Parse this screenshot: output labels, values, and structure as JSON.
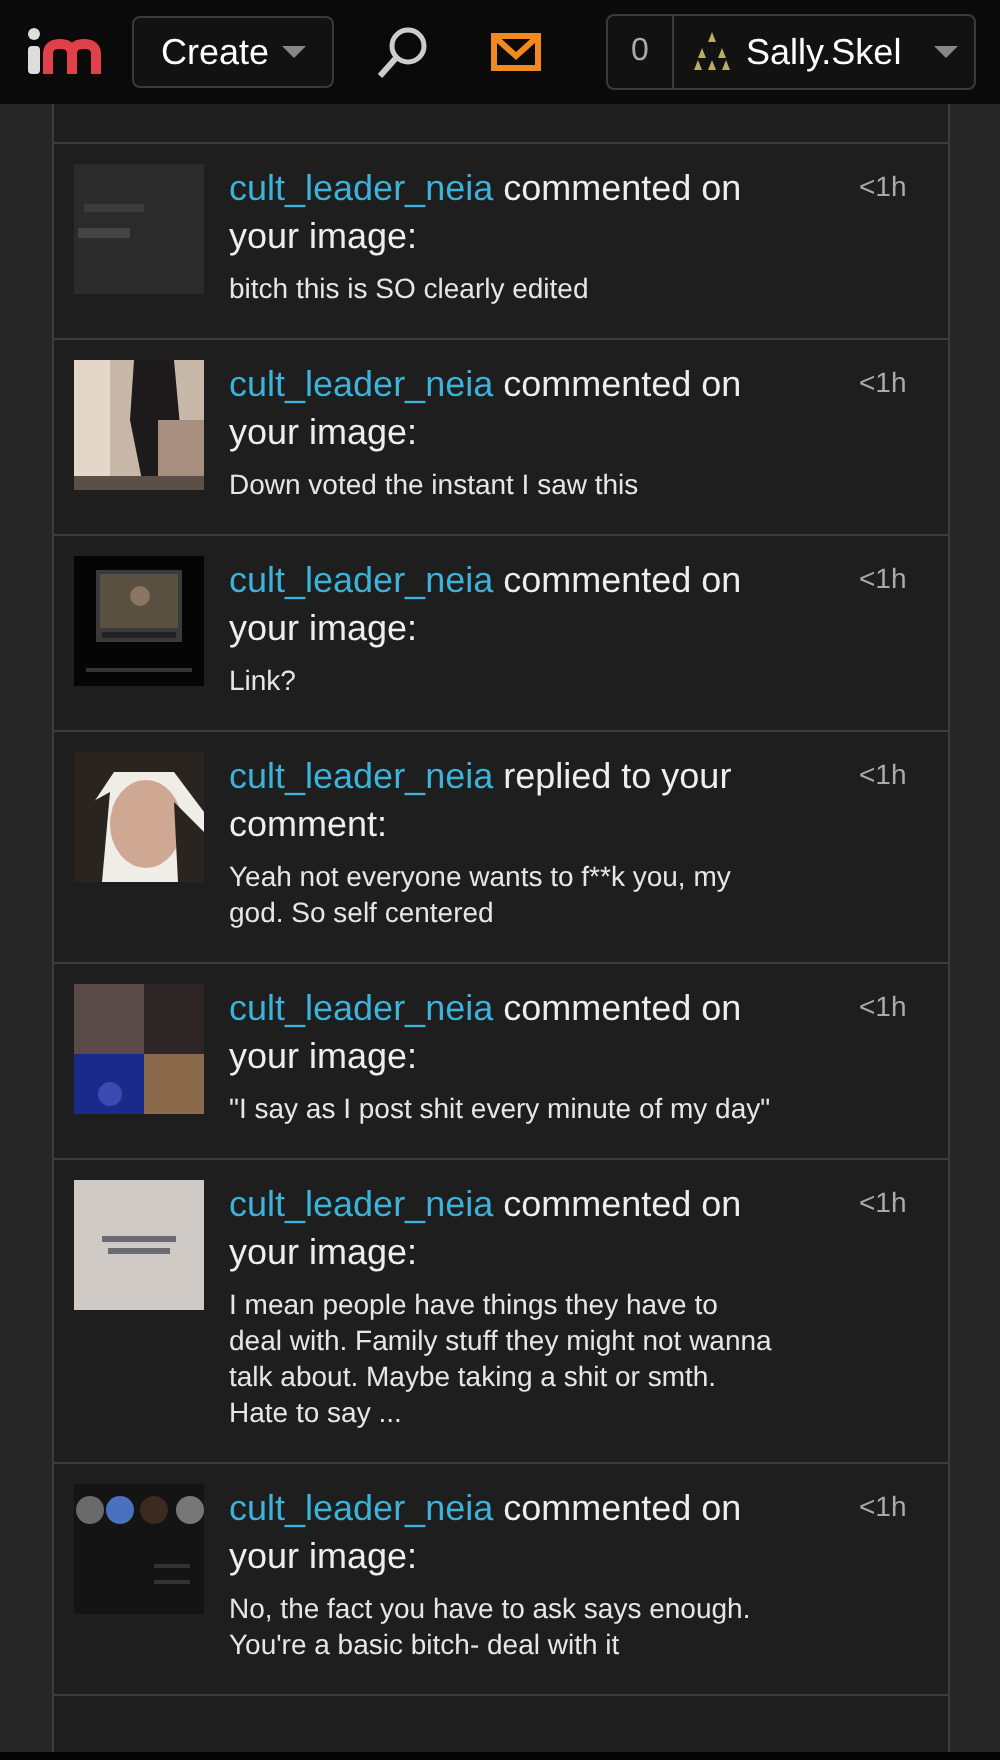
{
  "header": {
    "create": "Create",
    "count": "0",
    "username": "Sally.Skel"
  },
  "notifications": [
    {
      "user": "cult_leader_neia",
      "action": "commented on your image:",
      "comment": "bitch this is SO clearly edited",
      "time": "<1h"
    },
    {
      "user": "cult_leader_neia",
      "action": "commented on your image:",
      "comment": "Down voted the instant I saw this",
      "time": "<1h"
    },
    {
      "user": "cult_leader_neia",
      "action": "commented on your image:",
      "comment": "Link?",
      "time": "<1h"
    },
    {
      "user": "cult_leader_neia",
      "action": "replied to your comment:",
      "comment": "Yeah not everyone wants to f**k you, my god. So self centered",
      "time": "<1h"
    },
    {
      "user": "cult_leader_neia",
      "action": "commented on your image:",
      "comment": "\"I say as I post shit every minute of my day\"",
      "time": "<1h"
    },
    {
      "user": "cult_leader_neia",
      "action": "commented on your image:",
      "comment": "I mean people have things they have to deal with. Family stuff they might not wanna talk about. Maybe taking a shit or smth. Hate to say ...",
      "time": "<1h"
    },
    {
      "user": "cult_leader_neia",
      "action": "commented on your image:",
      "comment": "No, the fact you have to ask says enough. You're a basic bitch- deal with it",
      "time": "<1h"
    }
  ]
}
